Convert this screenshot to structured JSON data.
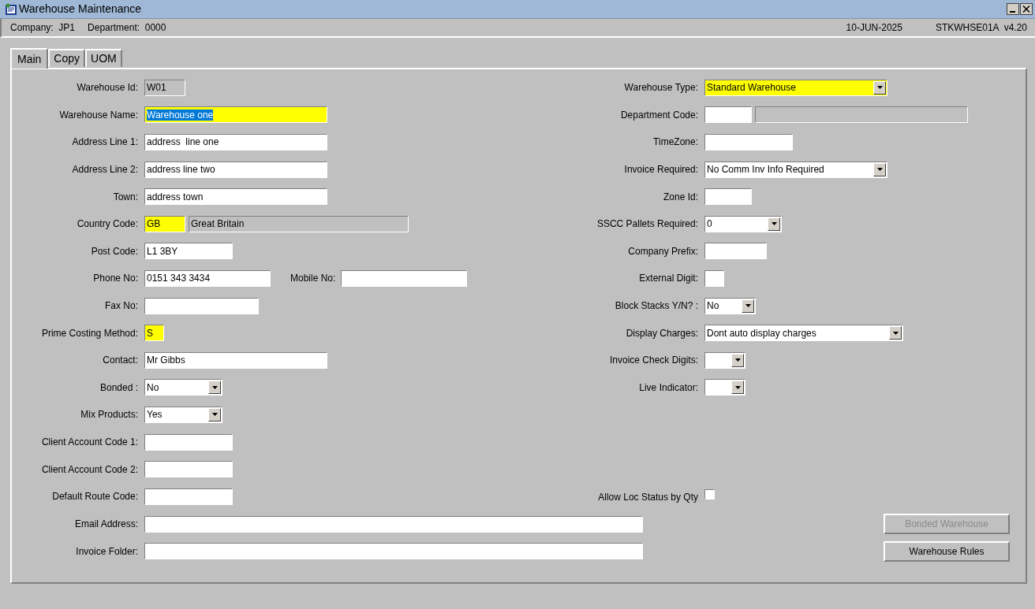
{
  "window": {
    "title": "Warehouse Maintenance"
  },
  "header": {
    "company_label": "Company:",
    "company": "JP1",
    "department_label": "Department:",
    "department": "0000",
    "date": "10-JUN-2025",
    "program": "STKWHSE01A",
    "version": "v4.20"
  },
  "tabs": [
    {
      "label": "Main",
      "selected": true
    },
    {
      "label": "Copy",
      "selected": false
    },
    {
      "label": "UOM",
      "selected": false
    }
  ],
  "left_fields": [
    {
      "label": "Warehouse Id:",
      "fields": [
        {
          "kind": "text",
          "value": "W01",
          "readonly": true
        }
      ]
    },
    {
      "label": "Warehouse Name:",
      "fields": [
        {
          "kind": "text",
          "value": "Warehouse one",
          "required": true,
          "text_selected": true
        }
      ]
    },
    {
      "label": "Address Line 1:",
      "fields": [
        {
          "kind": "text",
          "value": "address  line one",
          "readonly": false,
          "required": false
        }
      ]
    },
    {
      "label": "Address Line 2:",
      "fields": [
        {
          "kind": "text",
          "value": "address line two",
          "readonly": false,
          "required": false
        }
      ]
    },
    {
      "label": "Town:",
      "fields": [
        {
          "kind": "text",
          "value": "address town",
          "readonly": false,
          "required": false
        }
      ]
    },
    {
      "label": "Country Code:",
      "fields": [
        {
          "kind": "text",
          "value": "GB",
          "required": true
        },
        {
          "kind": "text",
          "value": "Great Britain",
          "readonly": true
        }
      ]
    },
    {
      "label": "Post Code:",
      "fields": [
        {
          "kind": "text",
          "value": "L1 3BY",
          "readonly": false,
          "required": false
        }
      ]
    },
    {
      "label": "Phone No:",
      "fields": [
        {
          "kind": "text",
          "value": "0151 343 3434",
          "readonly": false,
          "required": false
        },
        {
          "kind": "label",
          "value": "Mobile No:"
        },
        {
          "kind": "text",
          "readonly": false,
          "required": false
        }
      ]
    },
    {
      "label": "Fax No:",
      "fields": [
        {
          "kind": "text",
          "readonly": false,
          "required": false
        }
      ]
    },
    {
      "label": "Prime Costing Method:",
      "fields": [
        {
          "kind": "text",
          "value": "S",
          "required": true
        }
      ]
    },
    {
      "label": "Contact:",
      "fields": [
        {
          "kind": "text",
          "value": "Mr Gibbs",
          "readonly": false,
          "required": false
        }
      ]
    },
    {
      "label": "Bonded :",
      "fields": [
        {
          "kind": "select",
          "value": "No",
          "readonly": false,
          "required": false
        }
      ]
    },
    {
      "label": "Mix Products:",
      "fields": [
        {
          "kind": "select",
          "value": "Yes",
          "readonly": false,
          "required": false
        }
      ]
    },
    {
      "label": "Client Account Code 1:",
      "fields": [
        {
          "kind": "text",
          "readonly": false,
          "required": false
        }
      ]
    },
    {
      "label": "Client Account Code 2:",
      "fields": [
        {
          "kind": "text",
          "readonly": false,
          "required": false
        }
      ]
    },
    {
      "label": "Default Route Code:",
      "fields": [
        {
          "kind": "text",
          "readonly": false,
          "required": false
        }
      ]
    }
  ],
  "right_fields": [
    {
      "label": "Warehouse Type:",
      "fields": [
        {
          "kind": "select",
          "value": "Standard Warehouse",
          "required": true
        }
      ]
    },
    {
      "label": "Department Code:",
      "fields": [
        {
          "kind": "text",
          "readonly": false,
          "required": false
        },
        {
          "kind": "text",
          "readonly": true
        }
      ]
    },
    {
      "label": "TimeZone:",
      "fields": [
        {
          "kind": "text",
          "readonly": false,
          "required": false
        }
      ]
    },
    {
      "label": "Invoice Required:",
      "fields": [
        {
          "kind": "select",
          "value": "No Comm Inv Info Required",
          "readonly": false,
          "required": false
        }
      ]
    },
    {
      "label": "Zone Id:",
      "fields": [
        {
          "kind": "text",
          "readonly": false,
          "required": false
        }
      ]
    },
    {
      "label": "SSCC Pallets Required:",
      "fields": [
        {
          "kind": "select",
          "value": "0",
          "readonly": false,
          "required": false
        }
      ]
    },
    {
      "label": "Company Prefix:",
      "fields": [
        {
          "kind": "text",
          "readonly": false,
          "required": false
        }
      ]
    },
    {
      "label": "External Digit:",
      "fields": [
        {
          "kind": "text",
          "readonly": false,
          "required": false
        }
      ]
    },
    {
      "label": "Block Stacks Y/N? :",
      "fields": [
        {
          "kind": "select",
          "value": "No",
          "readonly": false,
          "required": false
        }
      ]
    },
    {
      "label": "Display Charges:",
      "fields": [
        {
          "kind": "select",
          "value": "Dont auto display charges",
          "readonly": false,
          "required": false
        }
      ]
    },
    {
      "label": "Invoice Check Digits:",
      "fields": [
        {
          "kind": "select",
          "readonly": false,
          "required": false
        }
      ]
    },
    {
      "label": "Live Indicator:",
      "fields": [
        {
          "kind": "select",
          "readonly": false,
          "required": false
        }
      ]
    }
  ],
  "allow_loc_status": {
    "label": "Allow Loc Status by Qty",
    "checked": false
  },
  "bottom_fields": [
    {
      "label": "Email Address:",
      "fields": [
        {
          "kind": "text",
          "readonly": false,
          "required": false
        }
      ]
    },
    {
      "label": "Invoice Folder:",
      "fields": [
        {
          "kind": "text",
          "readonly": false,
          "required": false
        }
      ]
    }
  ],
  "buttons": [
    {
      "label": "Bonded Warehouse",
      "disabled": true
    },
    {
      "label": "Warehouse Rules",
      "disabled": false
    }
  ]
}
